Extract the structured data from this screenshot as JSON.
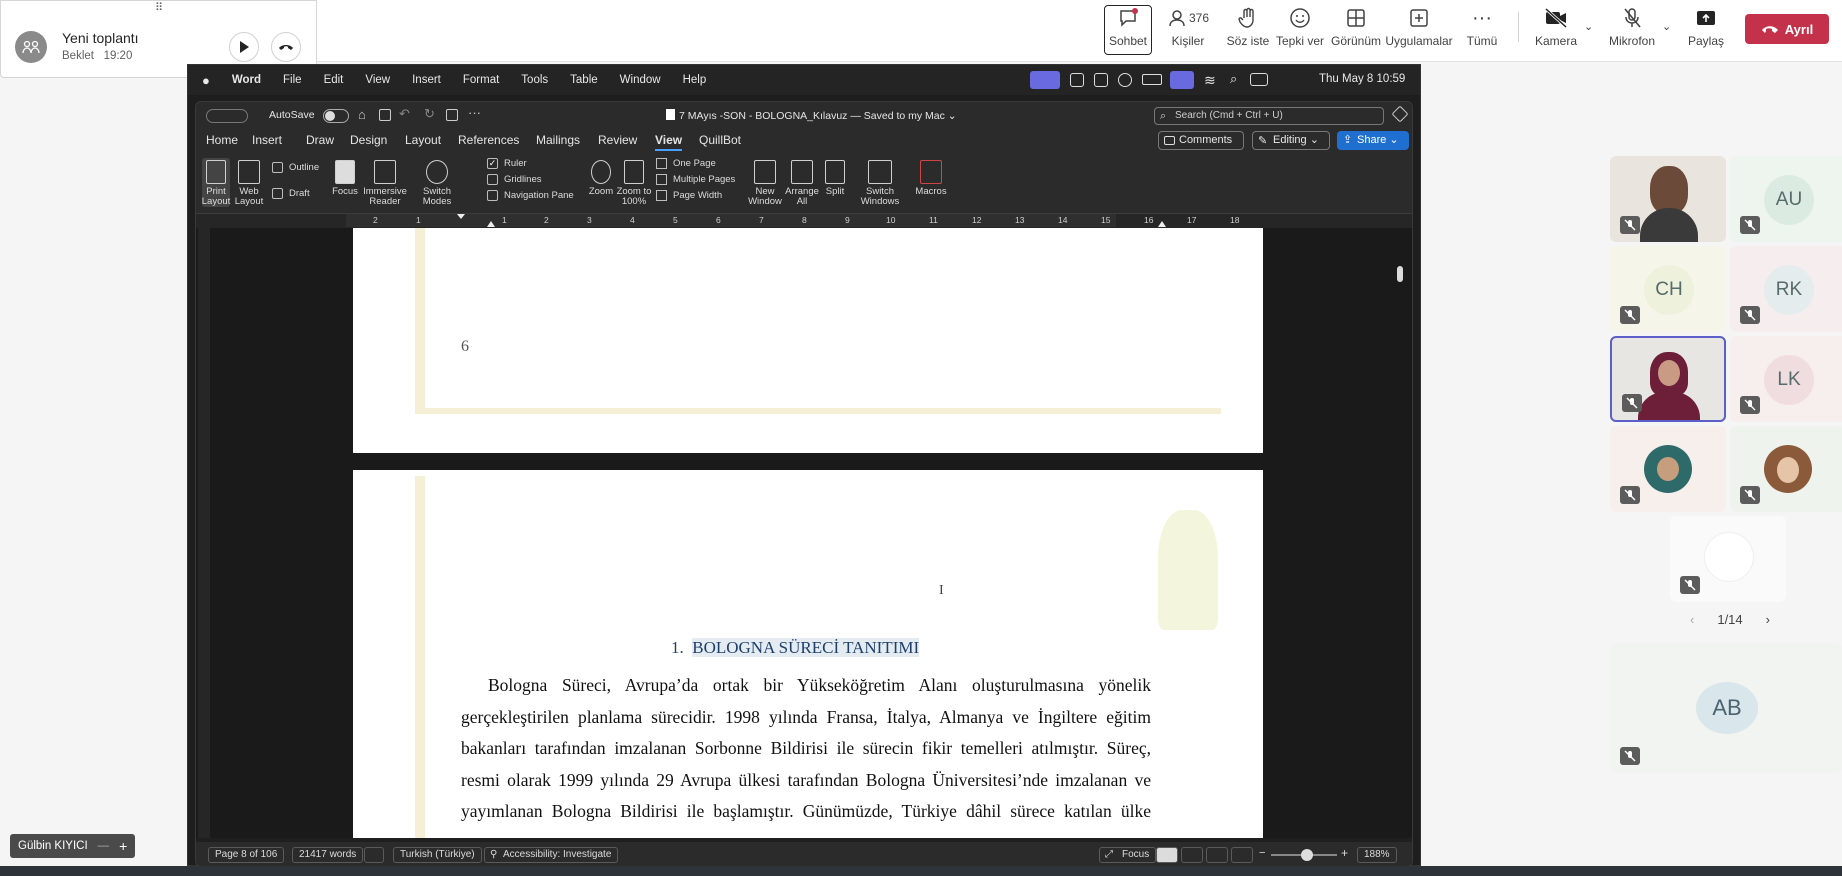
{
  "call": {
    "title": "Yeni toplantı",
    "status": "Beklet",
    "time": "19:20"
  },
  "toolbar": {
    "chat": "Sohbet",
    "people_count": "376",
    "people": "Kişiler",
    "raise_hand": "Söz iste",
    "react": "Tepki ver",
    "view": "Görünüm",
    "apps": "Uygulamalar",
    "more": "Tümü",
    "camera": "Kamera",
    "mic": "Mikrofon",
    "share": "Paylaş",
    "leave": "Ayrıl"
  },
  "mac_menu": {
    "app": "Word",
    "items": [
      "File",
      "Edit",
      "View",
      "Insert",
      "Format",
      "Tools",
      "Table",
      "Window",
      "Help"
    ],
    "clock": "Thu May 8  10:59"
  },
  "word": {
    "autosave": "AutoSave",
    "doc_title": "7 MAyıs -SON - BOLOGNA_Kılavuz — Saved to my Mac",
    "search_placeholder": "Search (Cmd + Ctrl + U)",
    "tabs": [
      "Home",
      "Insert",
      "Draw",
      "Design",
      "Layout",
      "References",
      "Mailings",
      "Review",
      "View",
      "QuillBot"
    ],
    "comments": "Comments",
    "editing": "Editing",
    "share": "Share",
    "ribbon": {
      "print_layout": "Print Layout",
      "web_layout": "Web Layout",
      "outline": "Outline",
      "draft": "Draft",
      "focus": "Focus",
      "immersive_reader": "Immersive Reader",
      "switch_modes": "Switch Modes",
      "ruler": "Ruler",
      "gridlines": "Gridlines",
      "navigation_pane": "Navigation Pane",
      "zoom": "Zoom",
      "zoom_100": "Zoom to 100%",
      "one_page": "One Page",
      "multiple_pages": "Multiple Pages",
      "page_width": "Page Width",
      "new_window": "New Window",
      "arrange_all": "Arrange All",
      "split": "Split",
      "switch_windows": "Switch Windows",
      "macros": "Macros"
    },
    "ruler_ticks": [
      "2",
      "1",
      "1",
      "2",
      "3",
      "4",
      "5",
      "6",
      "7",
      "8",
      "9",
      "10",
      "11",
      "12",
      "13",
      "14",
      "15",
      "16",
      "17",
      "18"
    ],
    "page_number": "6",
    "heading_num": "1.",
    "heading": "BOLOGNA SÜRECİ TANITIMI",
    "paragraph": [
      "Bologna Süreci, Avrupa’da ortak bir Yükseköğretim Alanı oluşturulmasına yönelik",
      "gerçekleştirilen planlama sürecidir. 1998 yılında Fransa, İtalya, Almanya ve İngiltere eğitim",
      "bakanları tarafından imzalanan Sorbonne Bildirisi ile sürecin fikir temelleri atılmıştır. Süreç,",
      "resmi olarak 1999 yılında 29 Avrupa ülkesi tarafından Bologna Üniversitesi’nde imzalanan ve",
      "yayımlanan Bologna Bildirisi ile başlamıştır. Günümüzde, Türkiye dâhil sürece katılan ülke"
    ],
    "status": {
      "page": "Page 8 of 106",
      "words": "21417 words",
      "language": "Turkish (Türkiye)",
      "accessibility": "Accessibility: Investigate",
      "focus": "Focus",
      "zoom": "188%"
    }
  },
  "gallery": {
    "participants": [
      "AU",
      "CH",
      "RK",
      "LK",
      "AB"
    ],
    "pager": "1/14"
  },
  "presenter": {
    "name": "Gülbin KIYICI"
  }
}
